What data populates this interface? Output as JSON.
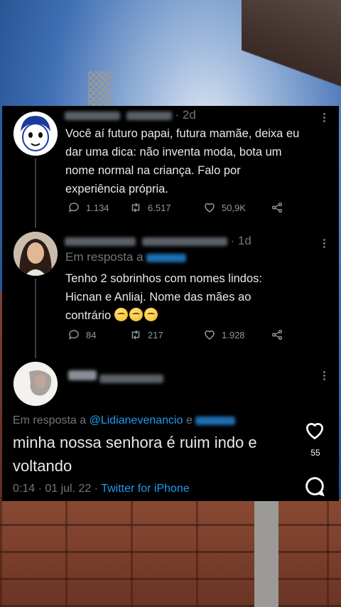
{
  "tweets": [
    {
      "age": "2d",
      "text_lines": [
        "Você aí futuro papai, futura mamãe, deixa eu",
        "dar uma dica: não inventa moda, bota um",
        "nome normal na criança. Falo por",
        "experiência própria."
      ],
      "replies": "1.134",
      "retweets": "6.517",
      "likes": "50,9K"
    },
    {
      "age": "1d",
      "reply_prefix": "Em resposta a",
      "text_lines": [
        "Tenho 2 sobrinhos com nomes lindos:",
        "Hicnan e Anliaj. Nome das mães ao",
        "contrário"
      ],
      "replies": "84",
      "retweets": "217",
      "likes": "1.928"
    }
  ],
  "main_tweet": {
    "reply_prefix": "Em resposta a",
    "reply_handle": "@Lidianevenancio",
    "reply_and": "e",
    "text_line1": "minha nossa senhora é ruim indo e",
    "text_line2": "voltando",
    "meta_time": "0:14 · 01 jul. 22 · ",
    "meta_source": "Twitter for iPhone"
  },
  "reel_sidebar": {
    "like_count": "55",
    "icons": [
      "heart-icon",
      "comment-icon"
    ]
  },
  "colors": {
    "link": "#1d9bf0",
    "card_bg": "#000000",
    "text": "#e7e9ea",
    "muted": "#71767b"
  }
}
